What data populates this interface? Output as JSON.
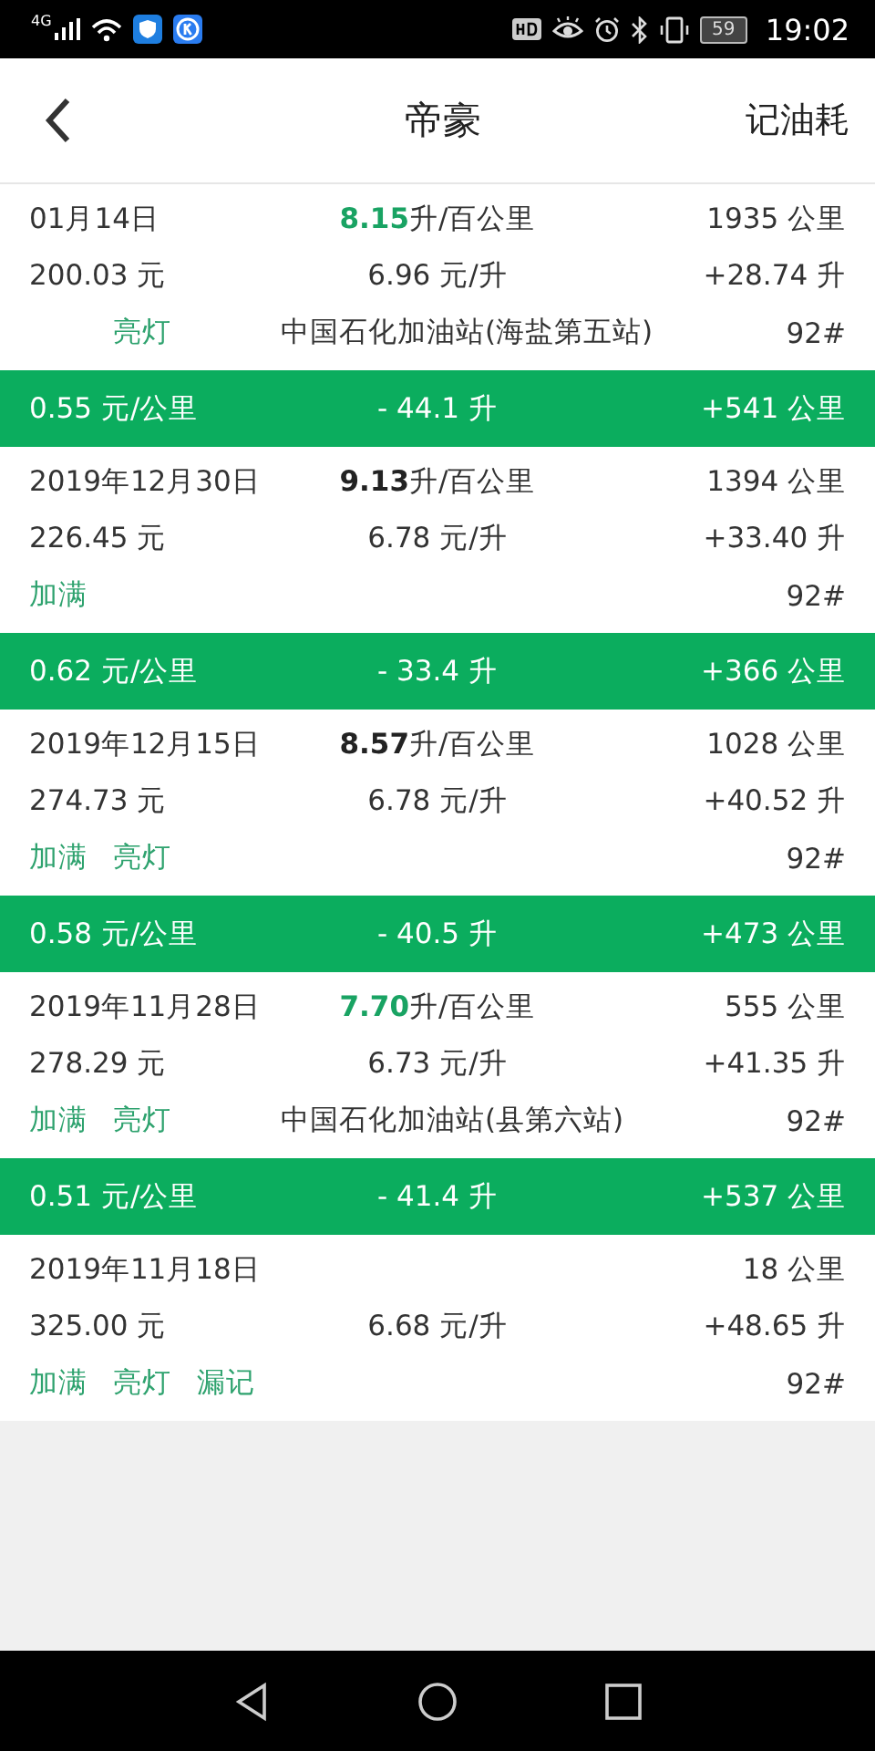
{
  "status_bar": {
    "network": "4G",
    "battery": "59",
    "time": "19:02"
  },
  "header": {
    "title": "帝豪",
    "action": "记油耗"
  },
  "entries": [
    {
      "kind": "record",
      "date": "01月14日",
      "consumption": {
        "value": "8.15",
        "unit": "升/百公里",
        "highlight": true
      },
      "distance": "1935 公里",
      "cost": "200.03 元",
      "price": "6.96 元/升",
      "volume": "+28.74 升",
      "tags": [
        {
          "kind": "light",
          "label": "亮灯"
        }
      ],
      "station": "中国石化加油站(海盐第五站)",
      "grade": "92#"
    },
    {
      "kind": "summary",
      "cost_per_km": "0.55 元/公里",
      "fuel_change": "- 44.1 升",
      "distance_change": "+541 公里"
    },
    {
      "kind": "record",
      "date": "2019年12月30日",
      "consumption": {
        "value": "9.13",
        "unit": "升/百公里",
        "highlight": false
      },
      "distance": "1394 公里",
      "cost": "226.45 元",
      "price": "6.78 元/升",
      "volume": "+33.40 升",
      "tags": [
        {
          "kind": "full",
          "label": "加满"
        }
      ],
      "grade": "92#"
    },
    {
      "kind": "summary",
      "cost_per_km": "0.62 元/公里",
      "fuel_change": "- 33.4 升",
      "distance_change": "+366 公里"
    },
    {
      "kind": "record",
      "date": "2019年12月15日",
      "consumption": {
        "value": "8.57",
        "unit": "升/百公里",
        "highlight": false
      },
      "distance": "1028 公里",
      "cost": "274.73 元",
      "price": "6.78 元/升",
      "volume": "+40.52 升",
      "tags": [
        {
          "kind": "full",
          "label": "加满"
        },
        {
          "kind": "light",
          "label": "亮灯"
        }
      ],
      "grade": "92#"
    },
    {
      "kind": "summary",
      "cost_per_km": "0.58 元/公里",
      "fuel_change": "- 40.5 升",
      "distance_change": "+473 公里"
    },
    {
      "kind": "record",
      "date": "2019年11月28日",
      "consumption": {
        "value": "7.70",
        "unit": "升/百公里",
        "highlight": true
      },
      "distance": "555 公里",
      "cost": "278.29 元",
      "price": "6.73 元/升",
      "volume": "+41.35 升",
      "tags": [
        {
          "kind": "full",
          "label": "加满"
        },
        {
          "kind": "light",
          "label": "亮灯"
        }
      ],
      "station": "中国石化加油站(县第六站)",
      "grade": "92#"
    },
    {
      "kind": "summary",
      "cost_per_km": "0.51 元/公里",
      "fuel_change": "- 41.4 升",
      "distance_change": "+537 公里"
    },
    {
      "kind": "record",
      "date": "2019年11月18日",
      "distance": "18 公里",
      "cost": "325.00 元",
      "price": "6.68 元/升",
      "volume": "+48.65 升",
      "tags": [
        {
          "kind": "full",
          "label": "加满"
        },
        {
          "kind": "light",
          "label": "亮灯"
        },
        {
          "kind": "missed",
          "label": "漏记"
        }
      ],
      "grade": "92#"
    }
  ]
}
